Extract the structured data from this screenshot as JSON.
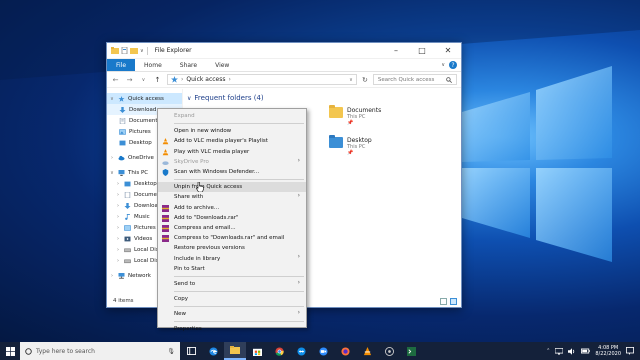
{
  "window": {
    "title": "File Explorer",
    "title_prefix": "∨",
    "controls": [
      "–",
      "□",
      "✕"
    ]
  },
  "ribbon": {
    "tabs": [
      "File",
      "Home",
      "Share",
      "View"
    ],
    "expand": "∨",
    "help": "?"
  },
  "address": {
    "back": "←",
    "forward": "→",
    "recent": "∨",
    "up": "↑",
    "path": "Quick access",
    "chev": "›",
    "dropdown": "∨",
    "refresh": "↻",
    "search_placeholder": "Search Quick access",
    "search_icon": "search-icon"
  },
  "nav": {
    "items": [
      {
        "label": "Quick access",
        "arrow": "∨",
        "icon": "star-icon"
      },
      {
        "label": "Download",
        "icon": "download-icon"
      },
      {
        "label": "Document",
        "icon": "document-icon"
      },
      {
        "label": "Pictures",
        "icon": "pictures-icon"
      },
      {
        "label": "Desktop",
        "icon": "desktop-folder-icon"
      },
      {
        "label": "OneDrive",
        "arrow": "›",
        "icon": "onedrive-icon"
      },
      {
        "label": "This PC",
        "arrow": "∨",
        "icon": "pc-icon"
      },
      {
        "label": "Desktop",
        "arrow": "›",
        "icon": "desktop-folder-icon"
      },
      {
        "label": "Documents",
        "arrow": "›",
        "icon": "document-icon"
      },
      {
        "label": "Download",
        "arrow": "›",
        "icon": "download-icon"
      },
      {
        "label": "Music",
        "arrow": "›",
        "icon": "music-icon"
      },
      {
        "label": "Pictures",
        "arrow": "›",
        "icon": "pictures-icon"
      },
      {
        "label": "Videos",
        "arrow": "›",
        "icon": "videos-icon"
      },
      {
        "label": "Local Disk",
        "arrow": "›",
        "icon": "disk-icon"
      },
      {
        "label": "Local Disk",
        "arrow": "›",
        "icon": "disk-icon"
      },
      {
        "label": "Network",
        "arrow": "›",
        "icon": "network-icon"
      }
    ]
  },
  "content": {
    "section": "Frequent folders (4)",
    "section_chev": "∨",
    "tiles": [
      {
        "name": "Documents",
        "sub": "This PC",
        "pin": "📌"
      },
      {
        "name": "Desktop",
        "sub": "This PC",
        "pin": "📌"
      }
    ]
  },
  "status": {
    "items": "4 items"
  },
  "context_menu": {
    "items": [
      {
        "label": "Expand",
        "disabled": true
      },
      {
        "sep": true
      },
      {
        "label": "Open in new window"
      },
      {
        "label": "Add to VLC media player's Playlist",
        "icon": "vlc-icon"
      },
      {
        "label": "Play with VLC media player",
        "icon": "vlc-icon"
      },
      {
        "label": "SkyDrive Pro",
        "disabled": true,
        "submenu": true,
        "icon": "skydrive-icon"
      },
      {
        "label": "Scan with Windows Defender...",
        "icon": "defender-icon"
      },
      {
        "sep": true
      },
      {
        "label": "Unpin from Quick access",
        "hover": true
      },
      {
        "label": "Share with",
        "submenu": true
      },
      {
        "label": "Add to archive...",
        "icon": "archive-icon"
      },
      {
        "label": "Add to \"Downloads.rar\"",
        "icon": "archive-icon"
      },
      {
        "label": "Compress and email...",
        "icon": "archive-icon"
      },
      {
        "label": "Compress to \"Downloads.rar\" and email",
        "icon": "archive-icon"
      },
      {
        "label": "Restore previous versions"
      },
      {
        "label": "Include in library",
        "submenu": true
      },
      {
        "label": "Pin to Start"
      },
      {
        "sep": true
      },
      {
        "label": "Send to",
        "submenu": true
      },
      {
        "sep": true
      },
      {
        "label": "Copy"
      },
      {
        "sep": true
      },
      {
        "label": "New",
        "submenu": true
      },
      {
        "sep": true
      },
      {
        "label": "Properties"
      }
    ],
    "submenu_glyph": "›"
  },
  "taskbar": {
    "search_placeholder": "Type here to search",
    "mic": "🎙",
    "apps": [
      "task-view-icon",
      "edge-icon",
      "file-explorer-icon",
      "store-icon",
      "chrome-icon",
      "teamviewer-icon",
      "zoom-icon",
      "firefox-icon",
      "vlc-taskbar-icon",
      "app-icon",
      "terminal-icon"
    ],
    "time": "4:08 PM",
    "date": "8/22/2020"
  },
  "colors": {
    "accent": "#1979ca",
    "selection": "#cce8ff",
    "taskbar": "#14213a"
  }
}
